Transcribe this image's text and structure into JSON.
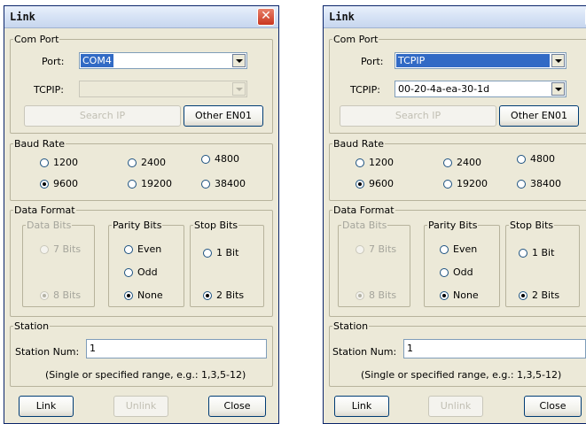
{
  "dialogs": [
    {
      "title": "Link",
      "close_glyph": "✕",
      "com_port": {
        "legend": "Com Port",
        "port_label": "Port:",
        "port_value": "COM4",
        "tcpip_label": "TCPIP:",
        "tcpip_value": "",
        "search_ip_label": "Search IP",
        "other_label": "Other EN01"
      },
      "baud_rate": {
        "legend": "Baud Rate",
        "options": [
          "1200",
          "2400",
          "4800",
          "9600",
          "19200",
          "38400"
        ],
        "selected": "9600"
      },
      "data_format": {
        "legend": "Data Format",
        "data_bits": {
          "legend": "Data Bits",
          "options": [
            "7 Bits",
            "8 Bits"
          ],
          "selected": "8 Bits"
        },
        "parity_bits": {
          "legend": "Parity Bits",
          "options": [
            "Even",
            "Odd",
            "None"
          ],
          "selected": "None"
        },
        "stop_bits": {
          "legend": "Stop Bits",
          "options": [
            "1 Bit",
            "2 Bits"
          ],
          "selected": "2 Bits"
        }
      },
      "station": {
        "legend": "Station",
        "label": "Station Num:",
        "value": "1",
        "hint": "(Single or specified range, e.g.: 1,3,5-12)"
      },
      "buttons": {
        "link": "Link",
        "unlink": "Unlink",
        "close": "Close"
      }
    },
    {
      "title": "Link",
      "close_glyph": "✕",
      "com_port": {
        "legend": "Com Port",
        "port_label": "Port:",
        "port_value": "TCPIP",
        "tcpip_label": "TCPIP:",
        "tcpip_value": "00-20-4a-ea-30-1d",
        "search_ip_label": "Search IP",
        "other_label": "Other EN01"
      },
      "baud_rate": {
        "legend": "Baud Rate",
        "options": [
          "1200",
          "2400",
          "4800",
          "9600",
          "19200",
          "38400"
        ],
        "selected": "9600"
      },
      "data_format": {
        "legend": "Data Format",
        "data_bits": {
          "legend": "Data Bits",
          "options": [
            "7 Bits",
            "8 Bits"
          ],
          "selected": "8 Bits"
        },
        "parity_bits": {
          "legend": "Parity Bits",
          "options": [
            "Even",
            "Odd",
            "None"
          ],
          "selected": "None"
        },
        "stop_bits": {
          "legend": "Stop Bits",
          "options": [
            "1 Bit",
            "2 Bits"
          ],
          "selected": "2 Bits"
        }
      },
      "station": {
        "legend": "Station",
        "label": "Station Num:",
        "value": "1",
        "hint": "(Single or specified range, e.g.: 1,3,5-12)"
      },
      "buttons": {
        "link": "Link",
        "unlink": "Unlink",
        "close": "Close"
      }
    }
  ]
}
